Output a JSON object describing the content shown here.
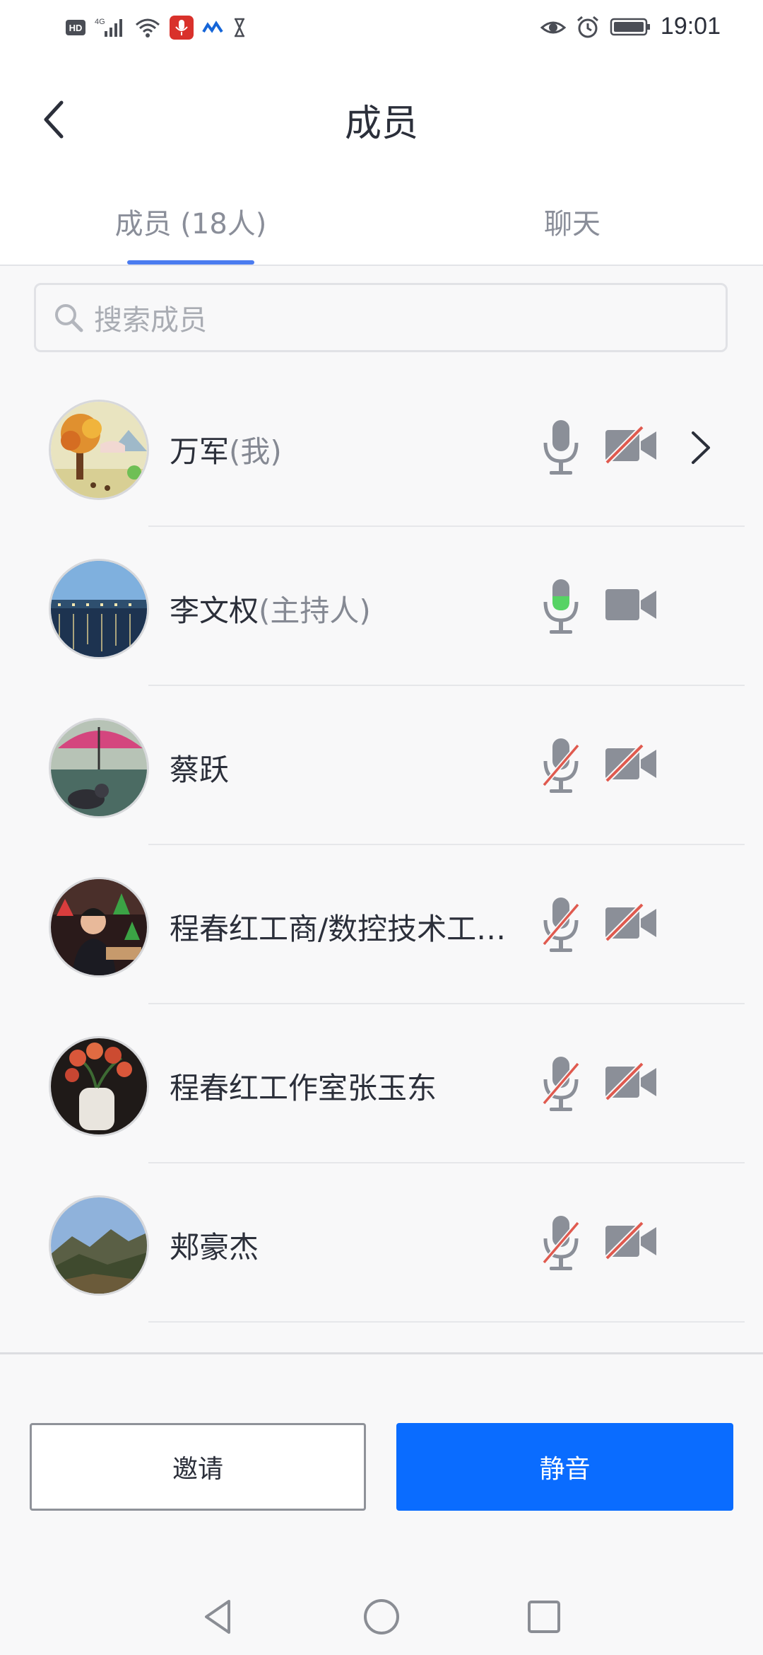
{
  "status_bar": {
    "time": "19:01",
    "left_icons": [
      "hd-icon",
      "signal-4g-icon",
      "wifi-icon",
      "mic-recording-icon",
      "app-icon",
      "hourglass-icon"
    ],
    "right_icons": [
      "eye-icon",
      "alarm-icon",
      "battery-icon"
    ]
  },
  "header": {
    "title": "成员",
    "tabs": [
      {
        "label": "成员 (18人)",
        "active": true
      },
      {
        "label": "聊天",
        "active": false
      }
    ]
  },
  "search": {
    "placeholder": "搜索成员"
  },
  "members": [
    {
      "name": "万军",
      "role": "(我)",
      "mic": "off-gray",
      "camera": "off",
      "has_chevron": true
    },
    {
      "name": "李文权",
      "role": "(主持人)",
      "mic": "active",
      "camera": "on",
      "has_chevron": false
    },
    {
      "name": "蔡跃",
      "role": "",
      "mic": "muted",
      "camera": "off",
      "has_chevron": false
    },
    {
      "name": "程春红工商/数控技术工作...",
      "role": "",
      "mic": "muted",
      "camera": "off",
      "has_chevron": false
    },
    {
      "name": "程春红工作室张玉东",
      "role": "",
      "mic": "muted",
      "camera": "off",
      "has_chevron": false
    },
    {
      "name": "郏豪杰",
      "role": "",
      "mic": "muted",
      "camera": "off",
      "has_chevron": false
    }
  ],
  "buttons": {
    "invite": "邀请",
    "mute": "静音"
  },
  "colors": {
    "accent": "#0a6cff",
    "tab_indicator": "#4b7cf0",
    "muted_slash": "#e05a4f",
    "mic_active": "#56d364"
  }
}
